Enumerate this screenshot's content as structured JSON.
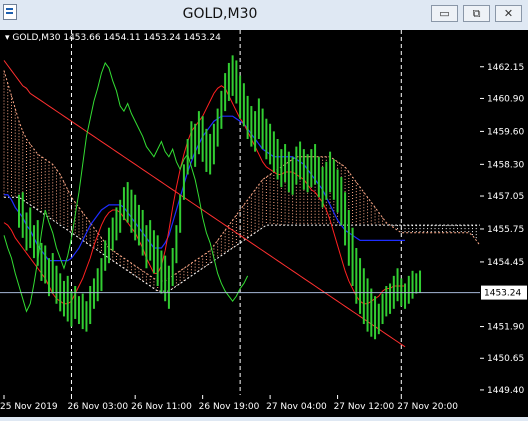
{
  "window": {
    "title": "GOLD,M30",
    "minimize_label": "▭",
    "restore_label": "⧉",
    "close_label": "✕"
  },
  "legend": {
    "symbol": "GOLD,M30",
    "ohlc": "1453.66 1454.11 1453.24 1453.24"
  },
  "chart_data": {
    "type": "line",
    "title": "",
    "background": "#000000",
    "ylim": [
      1449.2,
      1463.6
    ],
    "y_ticks": [
      1462.15,
      1460.9,
      1459.6,
      1458.3,
      1457.05,
      1455.75,
      1454.45,
      1451.9,
      1450.65,
      1449.4
    ],
    "x_ticks": [
      "25 Nov 2019",
      "26 Nov 03:00",
      "26 Nov 11:00",
      "26 Nov 19:00",
      "27 Nov 04:00",
      "27 Nov 12:00",
      "27 Nov 20:00"
    ],
    "vertical_separators": [
      "26 Nov 03:00",
      "26 Nov 19:00",
      "27 Nov 12:00"
    ],
    "last_price": 1453.24,
    "last_price_label": "1453.24",
    "grid": false,
    "x_index_range": [
      0,
      127
    ],
    "x_tick_index": [
      0,
      18,
      35,
      53,
      71,
      89,
      106
    ],
    "separator_index": [
      18,
      63,
      106
    ],
    "colors": {
      "candles": "#32cd32",
      "tenkan": "#ff2020",
      "kijun": "#1e2dff",
      "chikou": "#33dd33",
      "cloud_bull": "#ffaa88",
      "cloud_bear": "#ffffff",
      "slow_ma": "#ff3030",
      "price_line": "#a6b8d8",
      "axis_text": "#ffffff"
    },
    "series": [
      {
        "kind": "candles",
        "high": [
          1457.1,
          1457.2,
          1456.4,
          1456.6,
          1455.9,
          1456.1,
          1455.2,
          1455.1,
          1454.6,
          1454.8,
          1454.3,
          1454.0,
          1453.7,
          1453.9,
          1453.3,
          1453.5,
          1453.1,
          1453.2,
          1452.9,
          1453.5,
          1453.8,
          1454.2,
          1454.6,
          1455.3,
          1455.8,
          1456.2,
          1456.6,
          1456.9,
          1457.4,
          1457.6,
          1457.3,
          1457.1,
          1456.7,
          1456.5,
          1455.9,
          1456.1,
          1455.7,
          1455.5,
          1454.9,
          1454.7,
          1454.3,
          1455.0,
          1455.9,
          1457.1,
          1458.3,
          1459.3,
          1460.0,
          1459.9,
          1460.4,
          1460.2,
          1459.7,
          1459.5,
          1459.9,
          1460.5,
          1461.2,
          1461.9,
          1462.3,
          1462.6,
          1462.4,
          1461.8,
          1461.5,
          1461.0,
          1460.6,
          1460.4,
          1460.9,
          1460.5,
          1460.1,
          1459.9,
          1459.6,
          1459.3,
          1458.9,
          1459.1,
          1458.8,
          1458.6,
          1459.0,
          1459.2,
          1458.9,
          1458.7,
          1458.9,
          1459.1,
          1458.6,
          1458.2,
          1458.4,
          1458.8,
          1458.5,
          1458.1,
          1457.8,
          1457.2,
          1456.5,
          1455.8,
          1455.0,
          1454.6,
          1454.2,
          1453.8,
          1453.4,
          1453.1,
          1452.8,
          1453.2,
          1453.5,
          1453.6,
          1453.9,
          1454.2,
          1453.8,
          1453.6,
          1453.9,
          1454.1,
          1454.0,
          1454.11
        ],
        "low": [
          1455.8,
          1455.4,
          1454.9,
          1455.0,
          1454.6,
          1454.3,
          1453.7,
          1453.6,
          1453.1,
          1453.2,
          1452.8,
          1452.5,
          1452.3,
          1452.1,
          1451.9,
          1452.2,
          1452.0,
          1451.8,
          1451.7,
          1452.0,
          1452.6,
          1452.9,
          1453.3,
          1454.1,
          1454.4,
          1454.9,
          1455.3,
          1455.6,
          1456.1,
          1456.0,
          1455.6,
          1455.3,
          1455.1,
          1454.7,
          1454.2,
          1454.5,
          1454.0,
          1453.5,
          1453.2,
          1452.9,
          1452.6,
          1453.5,
          1454.4,
          1455.6,
          1456.9,
          1457.9,
          1458.5,
          1458.2,
          1458.7,
          1458.4,
          1458.0,
          1457.9,
          1458.3,
          1459.0,
          1459.7,
          1460.4,
          1460.8,
          1461.0,
          1460.7,
          1460.1,
          1459.8,
          1459.3,
          1459.0,
          1458.8,
          1459.3,
          1458.9,
          1458.5,
          1458.3,
          1458.0,
          1457.7,
          1457.4,
          1457.6,
          1457.2,
          1457.1,
          1457.5,
          1457.7,
          1457.3,
          1457.2,
          1457.4,
          1457.5,
          1457.0,
          1456.6,
          1456.9,
          1457.2,
          1456.9,
          1456.4,
          1455.9,
          1455.1,
          1454.3,
          1453.5,
          1452.8,
          1452.4,
          1452.0,
          1451.7,
          1451.5,
          1451.4,
          1451.6,
          1452.0,
          1452.3,
          1452.4,
          1452.6,
          1452.9,
          1452.7,
          1452.6,
          1452.8,
          1453.0,
          1453.2,
          1453.24
        ]
      },
      {
        "name": "",
        "kind": "tenkan",
        "values": [
          1456.0,
          1455.9,
          1455.7,
          1455.4,
          1455.2,
          1455.0,
          1454.8,
          1454.6,
          1454.4,
          1454.2,
          1454.0,
          1453.8,
          1453.5,
          1453.2,
          1453.0,
          1452.9,
          1452.8,
          1452.8,
          1452.9,
          1453.2,
          1453.5,
          1453.8,
          1454.2,
          1454.6,
          1455.1,
          1455.5,
          1455.9,
          1456.2,
          1456.4,
          1456.5,
          1456.5,
          1456.4,
          1456.2,
          1456.0,
          1455.8,
          1455.6,
          1455.3,
          1455.0,
          1454.6,
          1454.3,
          1454.0,
          1454.0,
          1454.3,
          1454.9,
          1455.7,
          1456.6,
          1457.4,
          1458.1,
          1458.7,
          1459.2,
          1459.6,
          1459.8,
          1460.0,
          1460.2,
          1460.5,
          1460.8,
          1461.1,
          1461.3,
          1461.4,
          1461.3,
          1461.0,
          1460.7,
          1460.4,
          1460.1,
          1459.9,
          1459.6,
          1459.3,
          1459.0,
          1458.7,
          1458.4,
          1458.2,
          1458.1,
          1458.0,
          1457.9,
          1457.9,
          1458.0,
          1458.0,
          1458.0,
          1457.9,
          1457.8,
          1457.7,
          1457.5,
          1457.3,
          1457.2,
          1457.0,
          1456.8,
          1456.5,
          1456.1,
          1455.6,
          1455.1,
          1454.6,
          1454.1,
          1453.7,
          1453.4,
          1453.1,
          1452.9,
          1452.8,
          1452.8,
          1452.9,
          1453.0,
          1453.1,
          1453.3,
          1453.4,
          1453.4,
          1453.5,
          1453.5,
          1453.5,
          1453.5
        ]
      },
      {
        "name": "",
        "kind": "kijun",
        "values": [
          1457.1,
          1457.1,
          1456.9,
          1456.6,
          1456.4,
          1456.2,
          1455.9,
          1455.7,
          1455.4,
          1455.1,
          1454.9,
          1454.7,
          1454.5,
          1454.5,
          1454.5,
          1454.5,
          1454.5,
          1454.5,
          1454.6,
          1454.8,
          1455.0,
          1455.3,
          1455.6,
          1455.9,
          1456.1,
          1456.3,
          1456.5,
          1456.6,
          1456.7,
          1456.7,
          1456.7,
          1456.7,
          1456.6,
          1456.4,
          1456.2,
          1456.0,
          1455.8,
          1455.6,
          1455.4,
          1455.2,
          1455.0,
          1455.0,
          1455.0,
          1455.2,
          1455.5,
          1456.0,
          1456.5,
          1457.0,
          1457.5,
          1458.0,
          1458.4,
          1458.8,
          1459.1,
          1459.4,
          1459.6,
          1459.8,
          1460.0,
          1460.1,
          1460.2,
          1460.2,
          1460.2,
          1460.2,
          1460.1,
          1460.0,
          1459.9,
          1459.7,
          1459.5,
          1459.3,
          1459.1,
          1458.9,
          1458.8,
          1458.7,
          1458.6,
          1458.6,
          1458.6,
          1458.6,
          1458.6,
          1458.6,
          1458.5,
          1458.4,
          1458.3,
          1458.1,
          1457.9,
          1457.7,
          1457.5,
          1457.3,
          1457.0,
          1456.7,
          1456.4,
          1456.1,
          1455.9,
          1455.7,
          1455.6,
          1455.5,
          1455.4,
          1455.3,
          1455.3,
          1455.3,
          1455.3,
          1455.3,
          1455.3,
          1455.3,
          1455.3,
          1455.3,
          1455.3,
          1455.3,
          1455.3,
          1455.3
        ]
      },
      {
        "name": "",
        "kind": "slow_ma",
        "values": [
          1462.4,
          1462.2,
          1462.0,
          1461.8,
          1461.6,
          1461.4,
          1461.3,
          1461.1,
          1461.0,
          1460.9,
          1460.8,
          1460.7,
          1460.6,
          1460.5,
          1460.4,
          1460.3,
          1460.2,
          1460.1,
          1460.0,
          1459.9,
          1459.8,
          1459.7,
          1459.6,
          1459.5,
          1459.4,
          1459.3,
          1459.2,
          1459.1,
          1459.0,
          1458.9,
          1458.8,
          1458.7,
          1458.6,
          1458.5,
          1458.4,
          1458.3,
          1458.2,
          1458.1,
          1458.0,
          1457.9,
          1457.8,
          1457.7,
          1457.6,
          1457.5,
          1457.4,
          1457.3,
          1457.2,
          1457.1,
          1457.0,
          1456.9,
          1456.8,
          1456.7,
          1456.6,
          1456.5,
          1456.4,
          1456.3,
          1456.2,
          1456.1,
          1456.0,
          1455.9,
          1455.8,
          1455.7,
          1455.6,
          1455.5,
          1455.4,
          1455.3,
          1455.2,
          1455.1,
          1455.0,
          1454.9,
          1454.8,
          1454.7,
          1454.6,
          1454.5,
          1454.4,
          1454.3,
          1454.2,
          1454.1,
          1454.0,
          1453.9,
          1453.8,
          1453.7,
          1453.6,
          1453.5,
          1453.4,
          1453.3,
          1453.2,
          1453.1,
          1453.0,
          1452.9,
          1452.8,
          1452.7,
          1452.6,
          1452.5,
          1452.4,
          1452.3,
          1452.2,
          1452.1,
          1452.0,
          1451.9,
          1451.8,
          1451.7,
          1451.6,
          1451.5,
          1451.4,
          1451.3,
          1451.2,
          1451.1
        ]
      },
      {
        "name": "",
        "kind": "cloud",
        "span_a": [
          1462.0,
          1461.5,
          1461.0,
          1460.5,
          1460.0,
          1459.6,
          1459.3,
          1459.1,
          1458.9,
          1458.7,
          1458.6,
          1458.5,
          1458.4,
          1458.3,
          1458.1,
          1457.9,
          1457.6,
          1457.3,
          1457.0,
          1456.8,
          1456.6,
          1456.4,
          1456.2,
          1456.0,
          1455.8,
          1455.6,
          1455.4,
          1455.2,
          1455.0,
          1454.9,
          1454.8,
          1454.7,
          1454.6,
          1454.5,
          1454.4,
          1454.3,
          1454.2,
          1454.1,
          1454.0,
          1453.9,
          1453.8,
          1453.7,
          1453.7,
          1453.7,
          1453.8,
          1453.9,
          1454.0,
          1454.1,
          1454.2,
          1454.3,
          1454.4,
          1454.5,
          1454.6,
          1454.7,
          1454.8,
          1454.9,
          1455.1,
          1455.3,
          1455.5,
          1455.7,
          1455.9,
          1456.1,
          1456.3,
          1456.5,
          1456.7,
          1456.9,
          1457.1,
          1457.3,
          1457.5,
          1457.7,
          1457.8,
          1457.9,
          1458.0,
          1458.1,
          1458.2,
          1458.3,
          1458.4,
          1458.5,
          1458.6,
          1458.6,
          1458.6,
          1458.6,
          1458.6,
          1458.6,
          1458.6,
          1458.6,
          1458.6,
          1458.6,
          1458.5,
          1458.4,
          1458.3,
          1458.2,
          1458.0,
          1457.8,
          1457.6,
          1457.4,
          1457.2,
          1457.0,
          1456.8,
          1456.6,
          1456.4,
          1456.2,
          1456.0,
          1455.9,
          1455.8,
          1455.7,
          1455.6,
          1455.6,
          1455.6,
          1455.6,
          1455.6,
          1455.6,
          1455.6,
          1455.6,
          1455.6,
          1455.6,
          1455.6,
          1455.6,
          1455.6,
          1455.6,
          1455.6,
          1455.6,
          1455.6,
          1455.6,
          1455.6,
          1455.5,
          1455.3,
          1455.1
        ],
        "span_b": [
          1457.0,
          1457.0,
          1457.0,
          1457.0,
          1457.0,
          1456.9,
          1456.8,
          1456.7,
          1456.6,
          1456.5,
          1456.4,
          1456.3,
          1456.2,
          1456.1,
          1456.0,
          1455.9,
          1455.8,
          1455.7,
          1455.6,
          1455.5,
          1455.4,
          1455.3,
          1455.2,
          1455.1,
          1455.0,
          1454.9,
          1454.8,
          1454.7,
          1454.6,
          1454.5,
          1454.4,
          1454.3,
          1454.2,
          1454.1,
          1454.0,
          1453.9,
          1453.8,
          1453.7,
          1453.6,
          1453.5,
          1453.4,
          1453.3,
          1453.3,
          1453.3,
          1453.3,
          1453.4,
          1453.5,
          1453.6,
          1453.7,
          1453.8,
          1453.9,
          1454.0,
          1454.1,
          1454.2,
          1454.3,
          1454.4,
          1454.5,
          1454.6,
          1454.7,
          1454.8,
          1454.9,
          1455.0,
          1455.1,
          1455.2,
          1455.3,
          1455.4,
          1455.5,
          1455.6,
          1455.7,
          1455.8,
          1455.9,
          1455.9,
          1455.9,
          1455.9,
          1455.9,
          1455.9,
          1455.9,
          1455.9,
          1455.9,
          1455.9,
          1455.9,
          1455.9,
          1455.9,
          1455.9,
          1455.9,
          1455.9,
          1455.9,
          1455.9,
          1455.9,
          1455.9,
          1455.9,
          1455.9,
          1455.9,
          1455.9,
          1455.9,
          1455.9,
          1455.9,
          1455.9,
          1455.9,
          1455.9,
          1455.9,
          1455.9,
          1455.9,
          1455.9,
          1455.9,
          1455.9,
          1455.9,
          1455.9,
          1455.9,
          1455.9,
          1455.9,
          1455.9,
          1455.9,
          1455.9,
          1455.9,
          1455.9,
          1455.9,
          1455.9,
          1455.9,
          1455.9,
          1455.9,
          1455.9,
          1455.9,
          1455.9,
          1455.9,
          1455.9,
          1455.9,
          1455.9
        ]
      },
      {
        "name": "",
        "kind": "chikou",
        "values": [
          1455.5,
          1455.0,
          1454.6,
          1454.0,
          1453.5,
          1453.0,
          1452.5,
          1452.8,
          1453.6,
          1454.5,
          1455.6,
          1456.5,
          1456.0,
          1455.6,
          1455.0,
          1454.6,
          1454.2,
          1454.7,
          1455.4,
          1456.3,
          1457.2,
          1458.3,
          1459.4,
          1460.1,
          1460.8,
          1461.3,
          1461.9,
          1462.3,
          1462.1,
          1461.6,
          1461.2,
          1460.6,
          1460.4,
          1460.7,
          1460.3,
          1460.0,
          1459.7,
          1459.4,
          1459.0,
          1458.8,
          1458.6,
          1458.9,
          1459.2,
          1458.8,
          1458.6,
          1458.9,
          1458.4,
          1458.1,
          1458.5,
          1458.7,
          1458.2,
          1457.7,
          1457.0,
          1456.2,
          1455.6,
          1455.2,
          1454.6,
          1454.0,
          1453.6,
          1453.3,
          1453.1,
          1452.9,
          1453.1,
          1453.4,
          1453.6,
          1453.9
        ]
      }
    ]
  }
}
